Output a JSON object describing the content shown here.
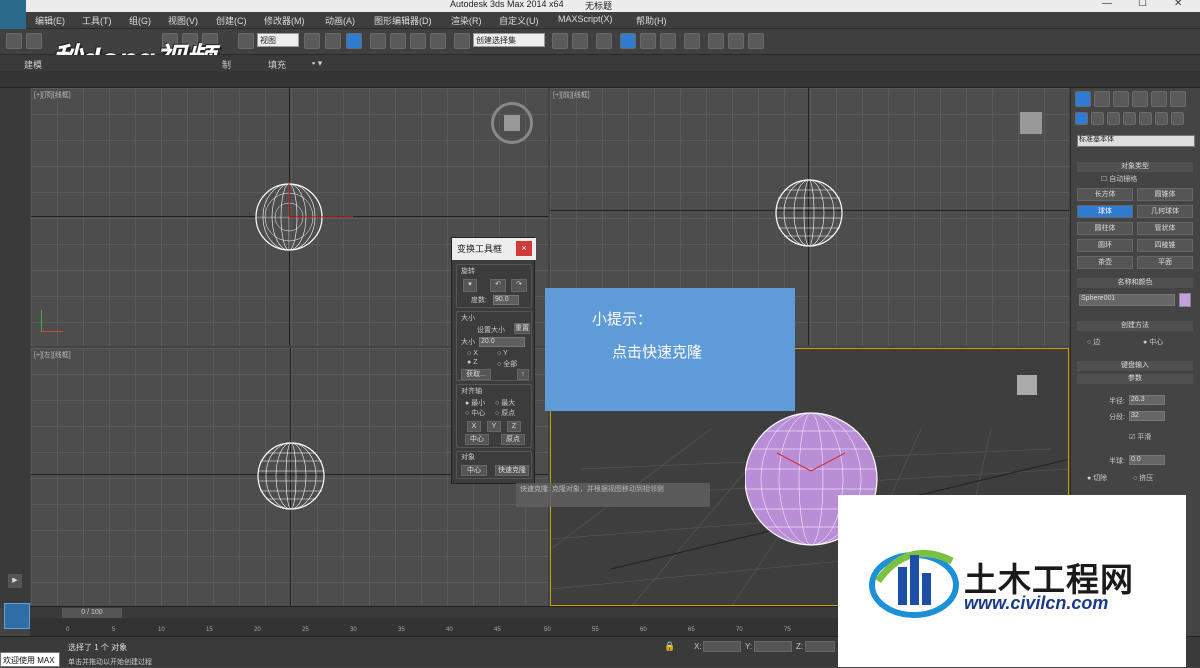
{
  "titlebar": {
    "title": "Autodesk 3ds Max  2014 x64",
    "doc": "无标题",
    "min": "—",
    "max": "☐",
    "close": "✕"
  },
  "menu": [
    "编辑(E)",
    "工具(T)",
    "组(G)",
    "视图(V)",
    "创建(C)",
    "修改器(M)",
    "动画(A)",
    "图形编辑器(D)",
    "渲染(R)",
    "自定义(U)",
    "MAXScript(X)",
    "帮助(H)"
  ],
  "toolbar": {
    "view_select": "视图",
    "selection_set": "创建选择集"
  },
  "ribbon": {
    "items": [
      "建模",
      "制",
      "填充"
    ]
  },
  "watermark": "秒dong视频",
  "viewports": {
    "top": "[+][顶][线框]",
    "front": "[+][前][线框]",
    "left": "[+][左][线框]"
  },
  "dialog": {
    "title": "变换工具框",
    "close": "×",
    "rotate_label": "旋转",
    "degrees_label": "度数:",
    "degrees_value": "90.0",
    "size_group": "大小",
    "set_size": "设置大小",
    "reset": "重置",
    "size_label": "大小",
    "size_value": "20.0",
    "radios_x": "X",
    "radios_y": "Y",
    "radios_z": "Z",
    "radios_all": "全部",
    "get": "获取...",
    "align_group": "对齐轴",
    "min": "最小",
    "max": "最大",
    "center": "中心",
    "pivot": "原点",
    "bx": "X",
    "by": "Y",
    "bz": "Z",
    "btn_center": "中心",
    "btn_pivot": "原点",
    "object_group": "对象",
    "obj_center": "中心",
    "quick_clone": "快速克隆"
  },
  "tooltip": "快速克隆: 克隆对象，并根据视图移动到相邻侧",
  "tip": {
    "title": "小提示：",
    "body": "点击快速克隆"
  },
  "command_panel": {
    "dropdown": "标准基本体",
    "object_type": "对象类型",
    "autogrid": "自动栅格",
    "buttons": [
      "长方体",
      "圆锥体",
      "球体",
      "几何球体",
      "圆柱体",
      "管状体",
      "圆环",
      "四棱锥",
      "茶壶",
      "平面"
    ],
    "name_color": "名称和颜色",
    "name_value": "Sphere001",
    "object_color": "#c79ee0",
    "creation_method": "创建方法",
    "edge": "边",
    "center": "中心",
    "keyboard_entry": "键盘输入",
    "params": "参数",
    "radius_label": "半径:",
    "radius_value": "26.3",
    "segments_label": "分段:",
    "segments_value": "32",
    "smooth": "平滑",
    "hemisphere_label": "半球:",
    "hemisphere_value": "0.0",
    "chop": "切除",
    "squash": "挤压"
  },
  "timeline": {
    "slider": "0 / 100",
    "ticks": [
      "0",
      "5",
      "10",
      "15",
      "20",
      "25",
      "30",
      "35",
      "40",
      "45",
      "50",
      "55",
      "60",
      "65",
      "70",
      "75",
      "80",
      "85",
      "90",
      "95",
      "100"
    ]
  },
  "status": {
    "line1": "选择了 1 个 对象",
    "line2": "单击并拖动以开始创建过程",
    "welcome": "欢迎使用 MAX",
    "x": "X:",
    "y": "Y:",
    "z": "Z:"
  },
  "brand": {
    "name": "土木工程网",
    "url": "www.civilcn.com"
  }
}
